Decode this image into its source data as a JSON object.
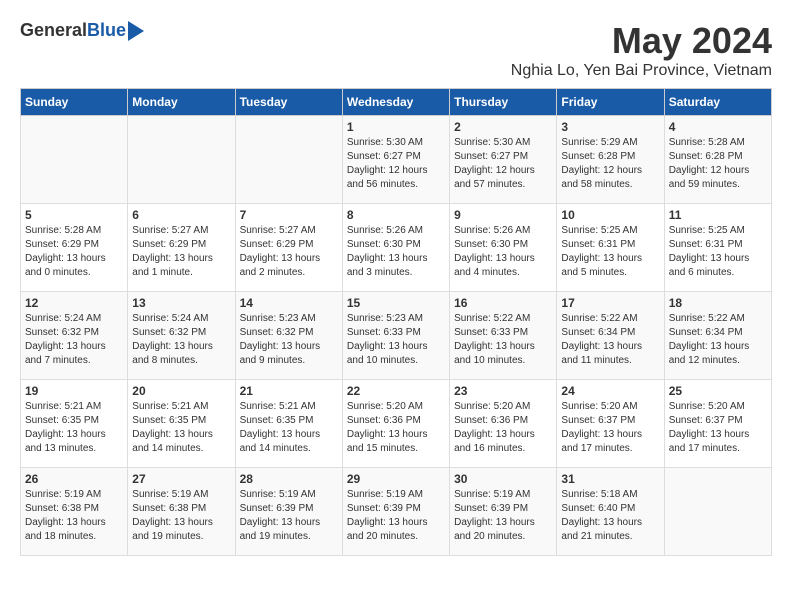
{
  "logo": {
    "general": "General",
    "blue": "Blue"
  },
  "title": {
    "month_year": "May 2024",
    "location": "Nghia Lo, Yen Bai Province, Vietnam"
  },
  "days_of_week": [
    "Sunday",
    "Monday",
    "Tuesday",
    "Wednesday",
    "Thursday",
    "Friday",
    "Saturday"
  ],
  "weeks": [
    [
      {
        "day": "",
        "detail": ""
      },
      {
        "day": "",
        "detail": ""
      },
      {
        "day": "",
        "detail": ""
      },
      {
        "day": "1",
        "detail": "Sunrise: 5:30 AM\nSunset: 6:27 PM\nDaylight: 12 hours\nand 56 minutes."
      },
      {
        "day": "2",
        "detail": "Sunrise: 5:30 AM\nSunset: 6:27 PM\nDaylight: 12 hours\nand 57 minutes."
      },
      {
        "day": "3",
        "detail": "Sunrise: 5:29 AM\nSunset: 6:28 PM\nDaylight: 12 hours\nand 58 minutes."
      },
      {
        "day": "4",
        "detail": "Sunrise: 5:28 AM\nSunset: 6:28 PM\nDaylight: 12 hours\nand 59 minutes."
      }
    ],
    [
      {
        "day": "5",
        "detail": "Sunrise: 5:28 AM\nSunset: 6:29 PM\nDaylight: 13 hours\nand 0 minutes."
      },
      {
        "day": "6",
        "detail": "Sunrise: 5:27 AM\nSunset: 6:29 PM\nDaylight: 13 hours\nand 1 minute."
      },
      {
        "day": "7",
        "detail": "Sunrise: 5:27 AM\nSunset: 6:29 PM\nDaylight: 13 hours\nand 2 minutes."
      },
      {
        "day": "8",
        "detail": "Sunrise: 5:26 AM\nSunset: 6:30 PM\nDaylight: 13 hours\nand 3 minutes."
      },
      {
        "day": "9",
        "detail": "Sunrise: 5:26 AM\nSunset: 6:30 PM\nDaylight: 13 hours\nand 4 minutes."
      },
      {
        "day": "10",
        "detail": "Sunrise: 5:25 AM\nSunset: 6:31 PM\nDaylight: 13 hours\nand 5 minutes."
      },
      {
        "day": "11",
        "detail": "Sunrise: 5:25 AM\nSunset: 6:31 PM\nDaylight: 13 hours\nand 6 minutes."
      }
    ],
    [
      {
        "day": "12",
        "detail": "Sunrise: 5:24 AM\nSunset: 6:32 PM\nDaylight: 13 hours\nand 7 minutes."
      },
      {
        "day": "13",
        "detail": "Sunrise: 5:24 AM\nSunset: 6:32 PM\nDaylight: 13 hours\nand 8 minutes."
      },
      {
        "day": "14",
        "detail": "Sunrise: 5:23 AM\nSunset: 6:32 PM\nDaylight: 13 hours\nand 9 minutes."
      },
      {
        "day": "15",
        "detail": "Sunrise: 5:23 AM\nSunset: 6:33 PM\nDaylight: 13 hours\nand 10 minutes."
      },
      {
        "day": "16",
        "detail": "Sunrise: 5:22 AM\nSunset: 6:33 PM\nDaylight: 13 hours\nand 10 minutes."
      },
      {
        "day": "17",
        "detail": "Sunrise: 5:22 AM\nSunset: 6:34 PM\nDaylight: 13 hours\nand 11 minutes."
      },
      {
        "day": "18",
        "detail": "Sunrise: 5:22 AM\nSunset: 6:34 PM\nDaylight: 13 hours\nand 12 minutes."
      }
    ],
    [
      {
        "day": "19",
        "detail": "Sunrise: 5:21 AM\nSunset: 6:35 PM\nDaylight: 13 hours\nand 13 minutes."
      },
      {
        "day": "20",
        "detail": "Sunrise: 5:21 AM\nSunset: 6:35 PM\nDaylight: 13 hours\nand 14 minutes."
      },
      {
        "day": "21",
        "detail": "Sunrise: 5:21 AM\nSunset: 6:35 PM\nDaylight: 13 hours\nand 14 minutes."
      },
      {
        "day": "22",
        "detail": "Sunrise: 5:20 AM\nSunset: 6:36 PM\nDaylight: 13 hours\nand 15 minutes."
      },
      {
        "day": "23",
        "detail": "Sunrise: 5:20 AM\nSunset: 6:36 PM\nDaylight: 13 hours\nand 16 minutes."
      },
      {
        "day": "24",
        "detail": "Sunrise: 5:20 AM\nSunset: 6:37 PM\nDaylight: 13 hours\nand 17 minutes."
      },
      {
        "day": "25",
        "detail": "Sunrise: 5:20 AM\nSunset: 6:37 PM\nDaylight: 13 hours\nand 17 minutes."
      }
    ],
    [
      {
        "day": "26",
        "detail": "Sunrise: 5:19 AM\nSunset: 6:38 PM\nDaylight: 13 hours\nand 18 minutes."
      },
      {
        "day": "27",
        "detail": "Sunrise: 5:19 AM\nSunset: 6:38 PM\nDaylight: 13 hours\nand 19 minutes."
      },
      {
        "day": "28",
        "detail": "Sunrise: 5:19 AM\nSunset: 6:39 PM\nDaylight: 13 hours\nand 19 minutes."
      },
      {
        "day": "29",
        "detail": "Sunrise: 5:19 AM\nSunset: 6:39 PM\nDaylight: 13 hours\nand 20 minutes."
      },
      {
        "day": "30",
        "detail": "Sunrise: 5:19 AM\nSunset: 6:39 PM\nDaylight: 13 hours\nand 20 minutes."
      },
      {
        "day": "31",
        "detail": "Sunrise: 5:18 AM\nSunset: 6:40 PM\nDaylight: 13 hours\nand 21 minutes."
      },
      {
        "day": "",
        "detail": ""
      }
    ]
  ]
}
